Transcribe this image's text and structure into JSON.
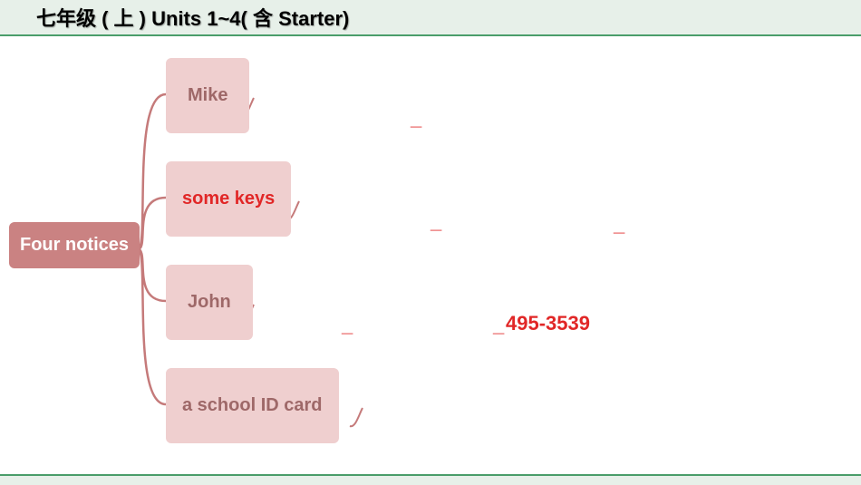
{
  "header": {
    "title": "七年级 ( 上 )  Units 1~4( 含 Starter)"
  },
  "root": {
    "label": "Four notices"
  },
  "children": {
    "mike": {
      "label": "Mike"
    },
    "keys": {
      "label": "some keys"
    },
    "john": {
      "label": "John"
    },
    "card": {
      "label": "a school ID card"
    }
  },
  "blanks": {
    "b1": "_",
    "b2": "_",
    "b3": "_",
    "b4": "_",
    "b5": "_"
  },
  "phone_number": "495-3539",
  "chart_data": {
    "type": "mindmap",
    "title": "七年级 ( 上 )  Units 1~4( 含 Starter)",
    "root": "Four notices",
    "branches": [
      {
        "label": "Mike",
        "emphasis": false,
        "details": [
          "_"
        ]
      },
      {
        "label": "some keys",
        "emphasis": true,
        "details": [
          "_",
          "_"
        ]
      },
      {
        "label": "John",
        "emphasis": false,
        "details": [
          "_",
          "_",
          "495-3539"
        ]
      },
      {
        "label": "a school ID card",
        "emphasis": false,
        "details": []
      }
    ]
  }
}
